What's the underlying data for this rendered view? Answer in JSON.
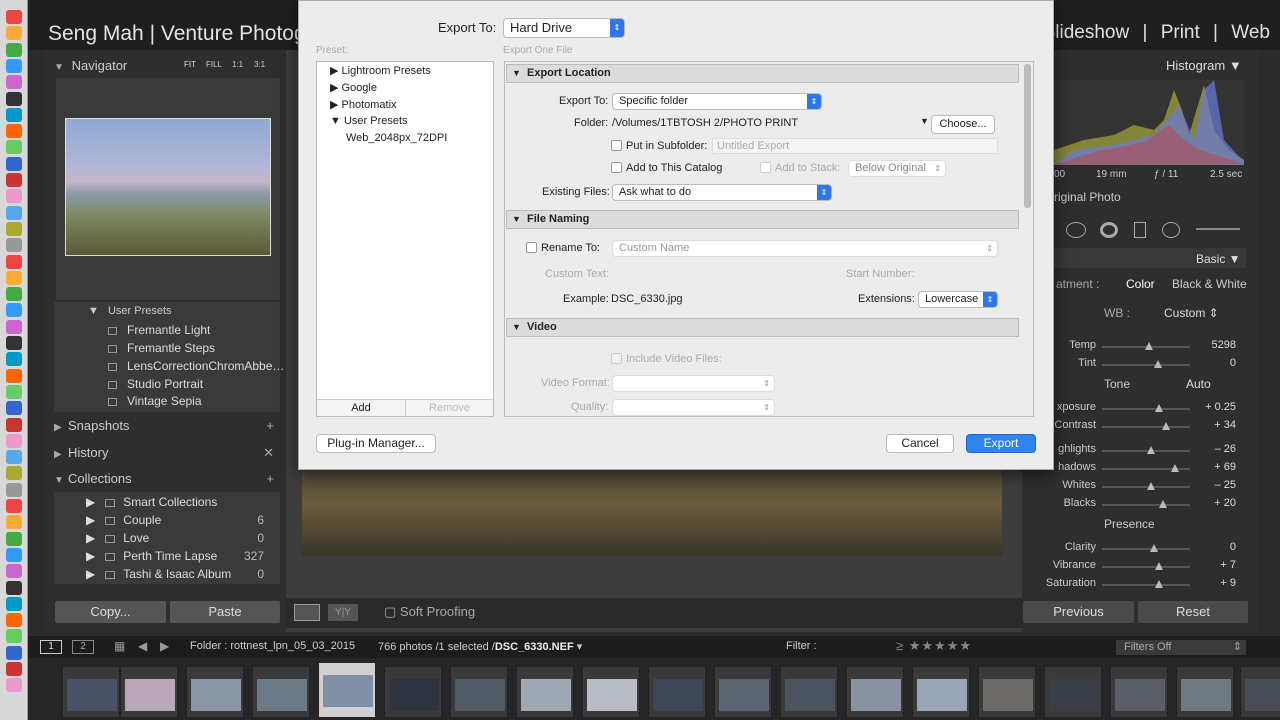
{
  "app": {
    "brand": "Seng Mah | Venture Photog",
    "modules": [
      "Slideshow",
      "|",
      "Print",
      "|",
      "Web"
    ]
  },
  "navigator": {
    "title": "Navigator",
    "zoom": [
      "FIT",
      "FILL",
      "1:1",
      "3:1"
    ]
  },
  "presets": {
    "group": "User Presets",
    "items": [
      "Fremantle Light",
      "Fremantle Steps",
      "LensCorrectionChromAbbe…",
      "Studio Portrait",
      "Vintage Sepia"
    ]
  },
  "panels": {
    "snapshots": "Snapshots",
    "history": "History",
    "collections": "Collections"
  },
  "collections": [
    {
      "name": "Smart Collections",
      "count": ""
    },
    {
      "name": "Couple",
      "count": "6"
    },
    {
      "name": "Love",
      "count": "0"
    },
    {
      "name": "Perth Time Lapse",
      "count": "327"
    },
    {
      "name": "Tashi & Isaac Album",
      "count": "0"
    }
  ],
  "left_buttons": {
    "copy": "Copy...",
    "paste": "Paste"
  },
  "toolbar": {
    "soft_proofing": "Soft Proofing"
  },
  "right": {
    "histogram": "Histogram",
    "exif": [
      "00",
      "19 mm",
      "ƒ / 11",
      "2.5 sec"
    ],
    "original": "riginal Photo",
    "basic": "Basic",
    "treatment": "atment :",
    "color": "Color",
    "bw": "Black & White",
    "wb_label": "WB :",
    "wb_value": "Custom",
    "tone": "Tone",
    "auto": "Auto",
    "presence": "Presence",
    "previous": "Previous",
    "reset": "Reset"
  },
  "sliders": [
    {
      "label": "Temp",
      "value": "5298",
      "pos": 0.72
    },
    {
      "label": "Tint",
      "value": "0",
      "pos": 0.86
    },
    {
      "label": "xposure",
      "value": "+ 0.25",
      "pos": 0.88
    },
    {
      "label": "Contrast",
      "value": "+ 34",
      "pos": 1.0
    },
    {
      "label": "ghlights",
      "value": "– 26",
      "pos": 0.75
    },
    {
      "label": "hadows",
      "value": "+ 69",
      "pos": 1.15
    },
    {
      "label": "Whites",
      "value": "– 25",
      "pos": 0.75
    },
    {
      "label": "Blacks",
      "value": "+ 20",
      "pos": 0.95
    },
    {
      "label": "Clarity",
      "value": "0",
      "pos": 0.8
    },
    {
      "label": "Vibrance",
      "value": "+ 7",
      "pos": 0.88
    },
    {
      "label": "Saturation",
      "value": "+ 9",
      "pos": 0.88
    }
  ],
  "filmstrip_bar": {
    "page1": "1",
    "page2": "2",
    "folder": "Folder : rottnest_lpn_05_03_2015",
    "count": "766 photos /1 selected /",
    "file": "DSC_6330.NEF",
    "filter": "Filter :",
    "filters_off": "Filters Off"
  },
  "dialog": {
    "export_to_label": "Export To:",
    "export_to_value": "Hard Drive",
    "preset_label": "Preset:",
    "export_one": "Export One File",
    "tree": [
      {
        "label": "Lightroom Presets",
        "open": false
      },
      {
        "label": "Google",
        "open": false
      },
      {
        "label": "Photomatix",
        "open": false
      },
      {
        "label": "User Presets",
        "open": true
      }
    ],
    "tree_child": "Web_2048px_72DPI",
    "add": "Add",
    "remove": "Remove",
    "plugin_manager": "Plug-in Manager...",
    "cancel": "Cancel",
    "export": "Export",
    "location": {
      "title": "Export Location",
      "export_to_label": "Export To:",
      "export_to_value": "Specific folder",
      "folder_label": "Folder:",
      "folder_value": "/Volumes/1TBTOSH 2/PHOTO PRINT",
      "choose": "Choose...",
      "subfolder_label": "Put in Subfolder:",
      "subfolder_placeholder": "Untitled Export",
      "add_catalog": "Add to This Catalog",
      "add_stack": "Add to Stack:",
      "below_original": "Below Original",
      "existing_label": "Existing Files:",
      "existing_value": "Ask what to do"
    },
    "naming": {
      "title": "File Naming",
      "rename_label": "Rename To:",
      "rename_value": "Custom Name",
      "custom_text": "Custom Text:",
      "start_number": "Start Number:",
      "example_label": "Example:",
      "example_value": "DSC_6330.jpg",
      "extensions_label": "Extensions:",
      "extensions_value": "Lowercase"
    },
    "video": {
      "title": "Video",
      "include": "Include Video Files:",
      "format": "Video Format:",
      "quality": "Quality:"
    }
  },
  "colors": {
    "accent": "#2e76ea",
    "panel": "#2e2e2e"
  }
}
